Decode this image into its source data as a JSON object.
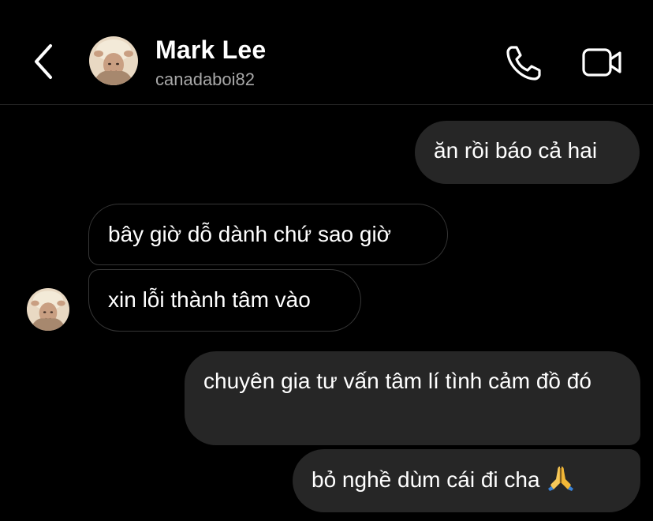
{
  "header": {
    "contact_name": "Mark Lee",
    "contact_handle": "canadaboi82",
    "back_icon": "chevron-left-icon",
    "call_icon": "phone-icon",
    "video_icon": "video-camera-icon"
  },
  "messages": [
    {
      "direction": "outgoing",
      "text": "ăn rồi báo cả hai"
    },
    {
      "direction": "incoming",
      "text": "bây giờ dỗ dành chứ sao giờ"
    },
    {
      "direction": "incoming",
      "text": "xin lỗi thành tâm vào"
    },
    {
      "direction": "outgoing",
      "text": "chuyên gia tư vấn tâm lí tình cảm đồ đó"
    },
    {
      "direction": "outgoing",
      "text": "bỏ nghề dùm cái đi cha",
      "emoji": "folded-hands-icon"
    }
  ],
  "colors": {
    "background": "#000000",
    "outgoing_bubble": "#262626",
    "incoming_border": "#363636",
    "secondary_text": "#a8a8a8"
  }
}
